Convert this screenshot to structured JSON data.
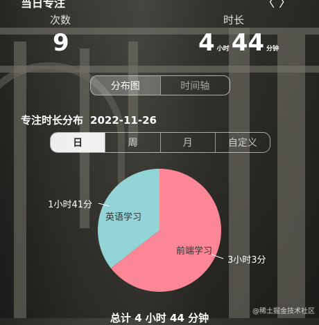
{
  "header": {
    "title": "当日专注",
    "nav_arrows": "〈 〉"
  },
  "stats": {
    "count": {
      "label": "次数",
      "value": "9"
    },
    "duration": {
      "label": "时长",
      "hours": "4",
      "hours_unit": "小时",
      "minutes": "44",
      "minutes_unit": "分钟"
    }
  },
  "view_tabs": [
    {
      "label": "分布图",
      "active": true
    },
    {
      "label": "时间轴",
      "active": false
    }
  ],
  "section": {
    "title": "专注时长分布",
    "date": "2022-11-26"
  },
  "period_tabs": [
    {
      "label": "日",
      "active": true
    },
    {
      "label": "周",
      "active": false
    },
    {
      "label": "月",
      "active": false
    },
    {
      "label": "自定义",
      "active": false
    }
  ],
  "chart_data": {
    "type": "pie",
    "slices": [
      {
        "name": "英语学习",
        "value": 101,
        "value_label": "1小时41分",
        "color": "#92d3d6"
      },
      {
        "name": "前端学习",
        "value": 183,
        "value_label": "3小时3分",
        "color": "#fb8695"
      }
    ]
  },
  "footer": {
    "total": "总计 4 小时 44 分钟"
  },
  "watermark": "@稀土掘金技术社区"
}
